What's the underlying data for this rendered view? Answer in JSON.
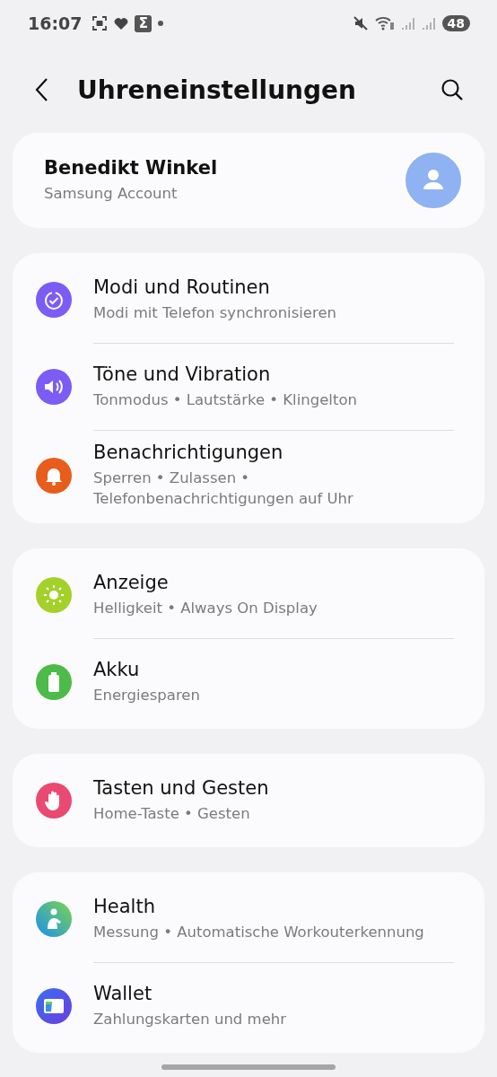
{
  "status_bar": {
    "time": "16:07",
    "app_badge": "Σ",
    "battery": "48"
  },
  "header": {
    "title": "Uhreneinstellungen"
  },
  "account": {
    "name": "Benedikt Winkel",
    "subtitle": "Samsung Account"
  },
  "groups": [
    {
      "items": [
        {
          "kind": "modes",
          "title": "Modi und Routinen",
          "subtitle": "Modi mit Telefon synchronisieren"
        },
        {
          "kind": "sound",
          "title": "Töne und Vibration",
          "subtitle": "Tonmodus • Lautstärke • Klingelton"
        },
        {
          "kind": "bell",
          "title": "Benachrichtigungen",
          "subtitle": "Sperren • Zulassen • Telefonbenachrichtigungen auf Uhr"
        }
      ]
    },
    {
      "items": [
        {
          "kind": "sun",
          "title": "Anzeige",
          "subtitle": "Helligkeit • Always On Display"
        },
        {
          "kind": "battery",
          "title": "Akku",
          "subtitle": "Energiesparen"
        }
      ]
    },
    {
      "items": [
        {
          "kind": "hand",
          "title": "Tasten und Gesten",
          "subtitle": "Home-Taste • Gesten"
        }
      ]
    },
    {
      "items": [
        {
          "kind": "health",
          "title": "Health",
          "subtitle": "Messung • Automatische Workouterkennung"
        },
        {
          "kind": "wallet",
          "title": "Wallet",
          "subtitle": "Zahlungskarten und mehr"
        }
      ]
    }
  ]
}
